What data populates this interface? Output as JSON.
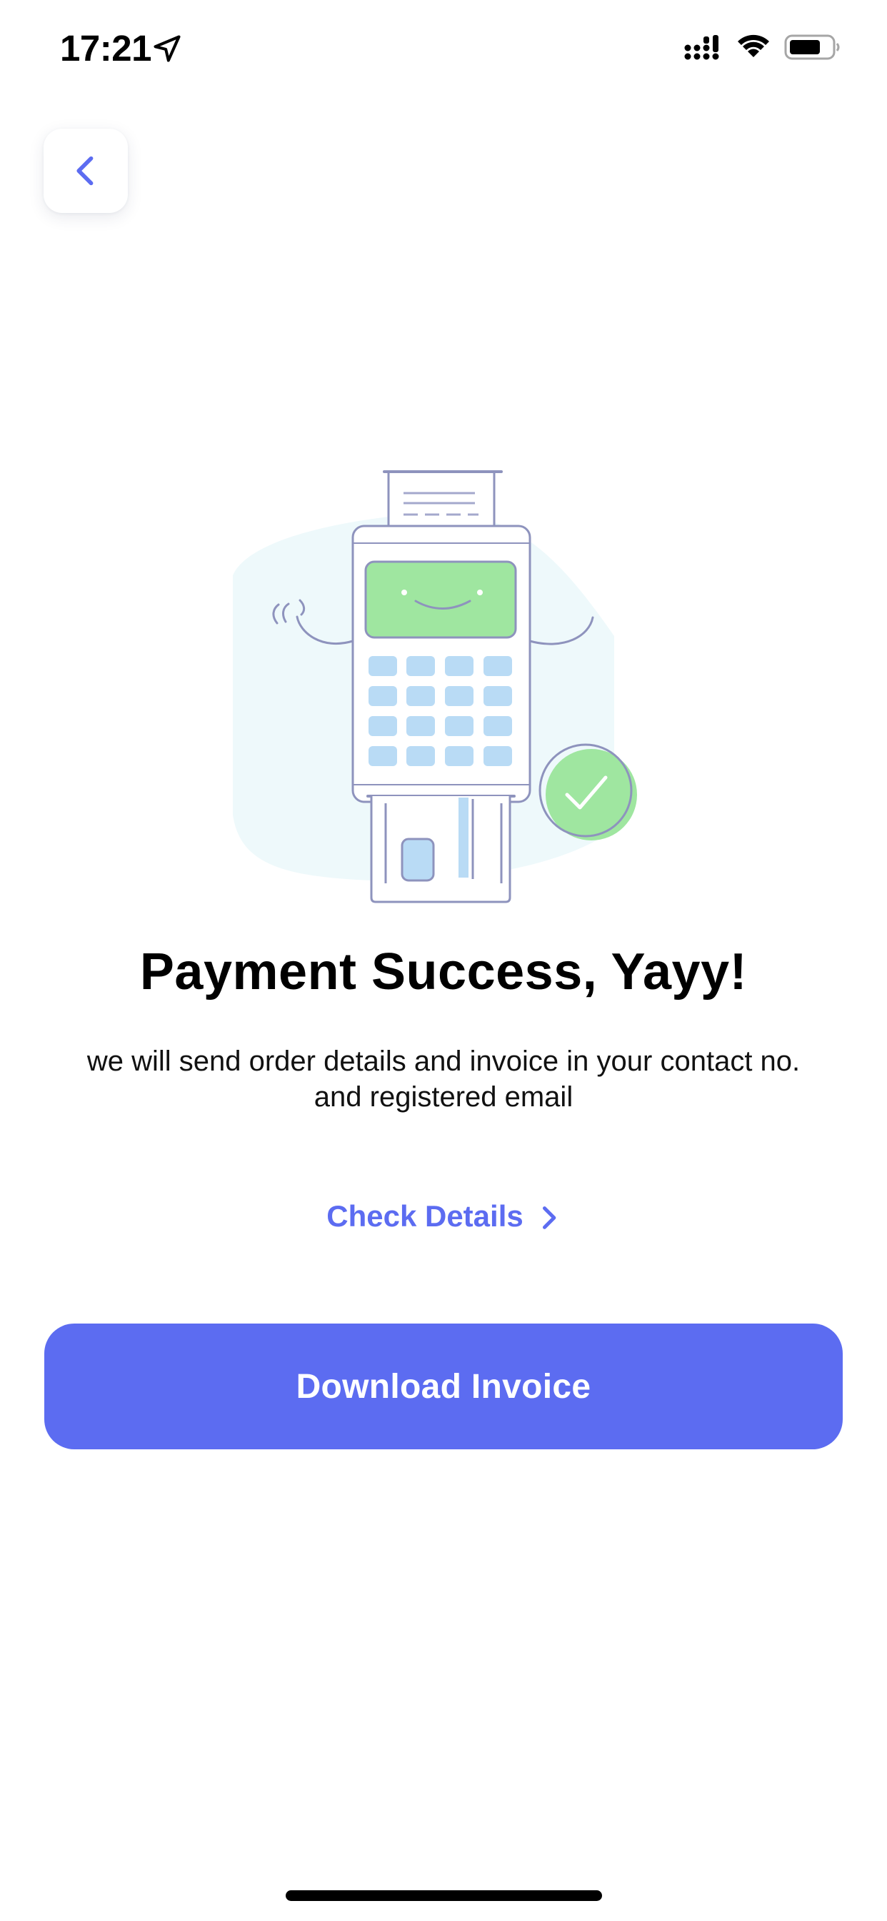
{
  "status_bar": {
    "time": "17:21",
    "icons": [
      "location-arrow-icon",
      "cellular-signal-icon",
      "wifi-icon",
      "battery-icon"
    ]
  },
  "nav": {
    "back_icon": "chevron-left-icon"
  },
  "illustration": {
    "subject": "payment-terminal-success-icon"
  },
  "content": {
    "title": "Payment Success, Yayy!",
    "subtitle_line1": "we will send order details and invoice in your contact no.",
    "subtitle_line2": "and registered email",
    "check_details_label": "Check Details",
    "check_details_icon": "chevron-right-icon",
    "download_button_label": "Download Invoice"
  },
  "colors": {
    "accent": "#5c6cf1",
    "success_green": "#9fe6a0",
    "key_blue": "#b9dbf5",
    "outline": "#8e93bd",
    "background_blob": "#eef9fb"
  }
}
